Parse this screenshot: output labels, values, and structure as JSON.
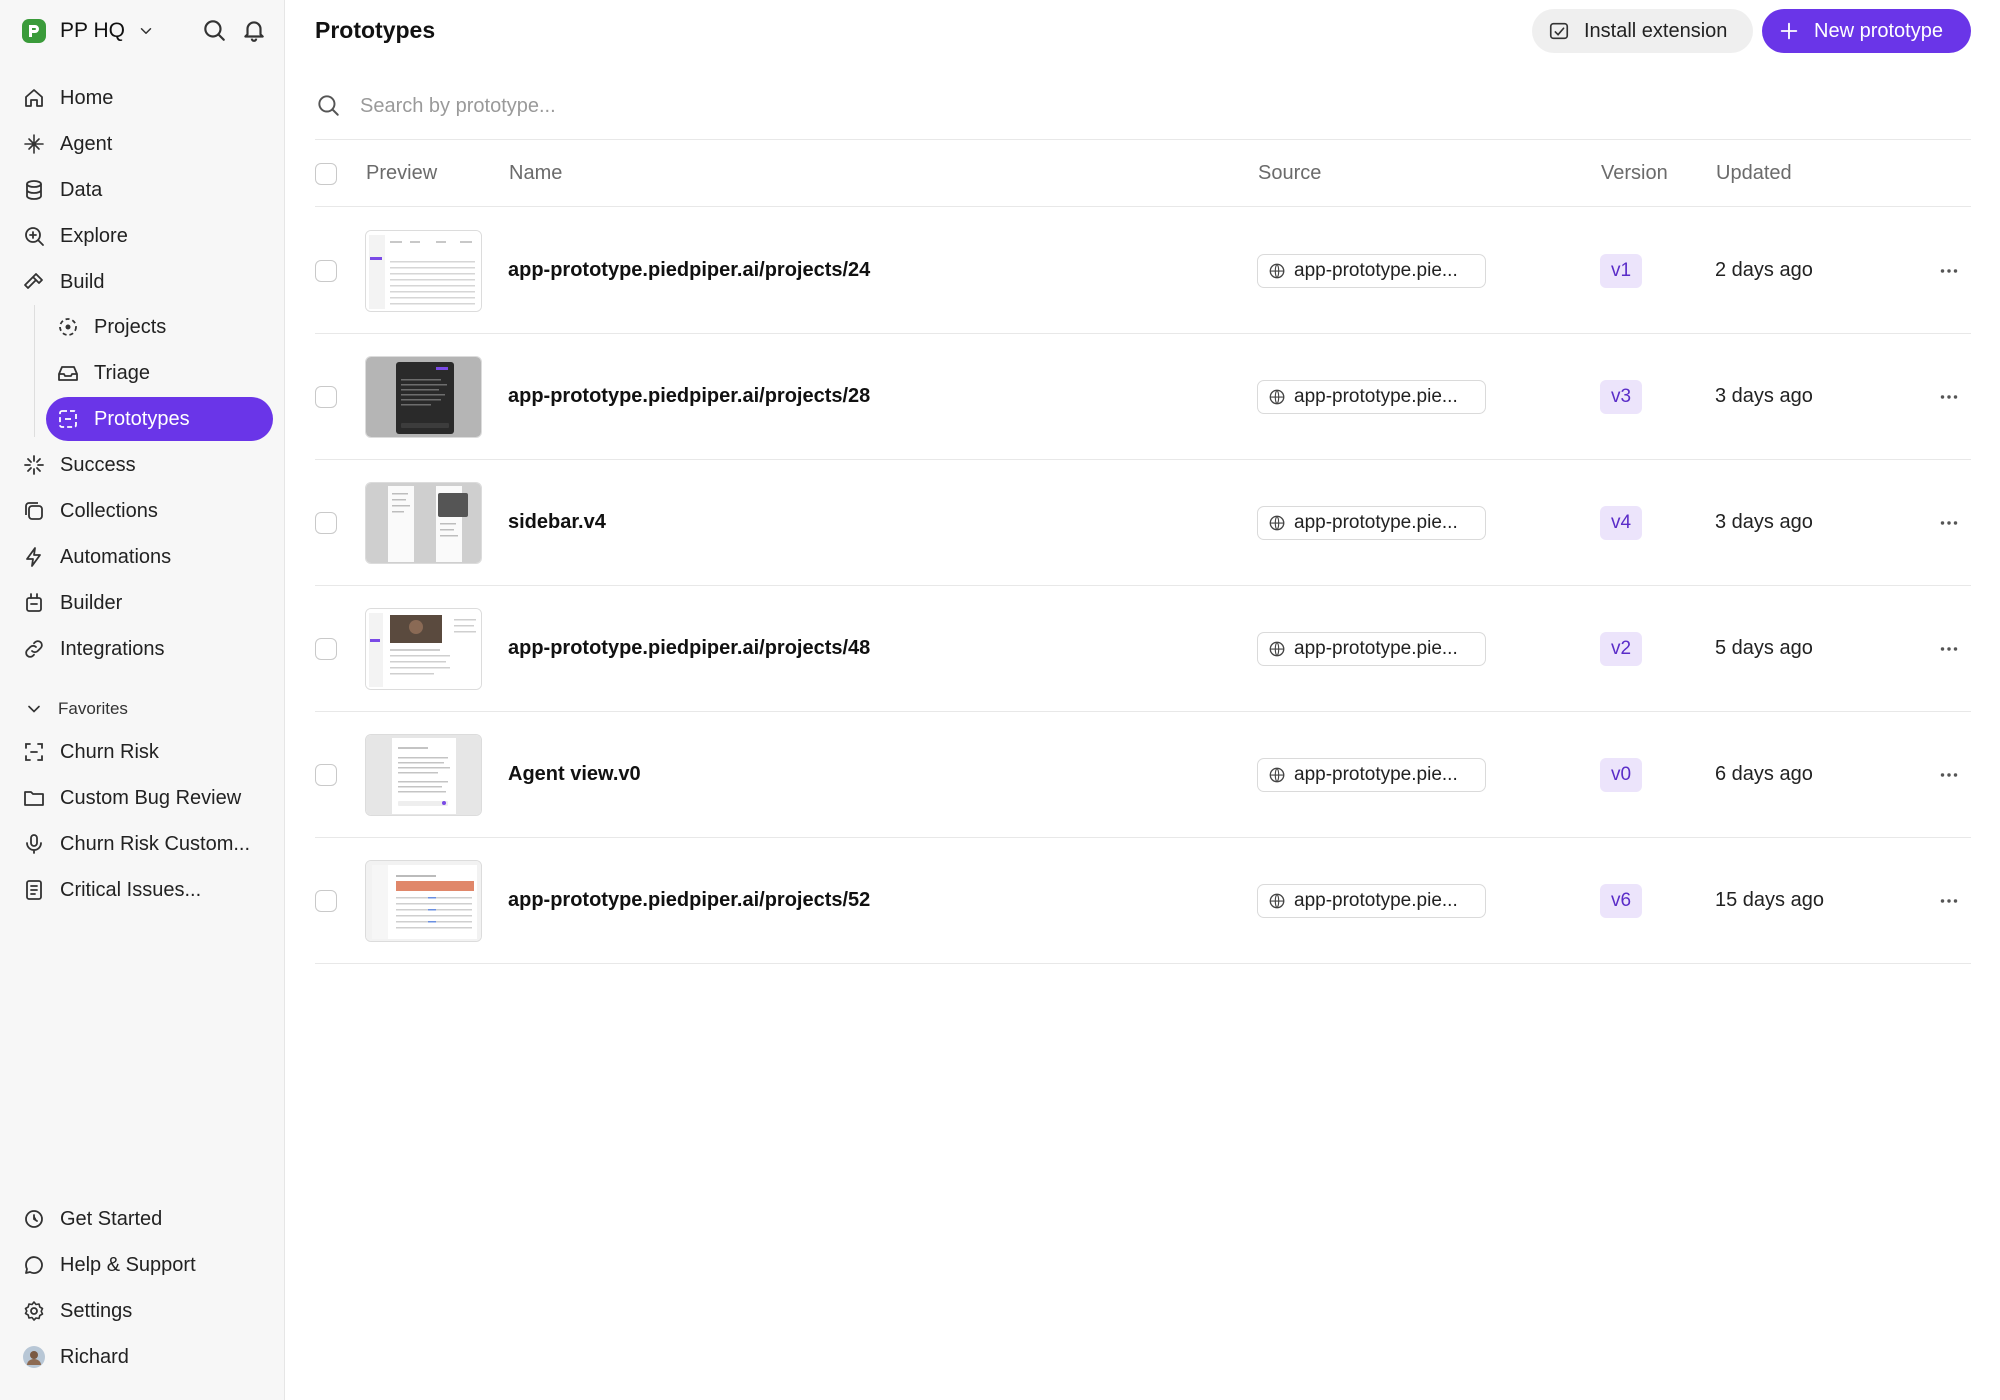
{
  "workspace": {
    "name": "PP HQ",
    "logo_color": "#3a9b3a"
  },
  "sidebar": {
    "nav": [
      {
        "label": "Home",
        "icon": "home-icon"
      },
      {
        "label": "Agent",
        "icon": "sparkle-icon"
      },
      {
        "label": "Data",
        "icon": "database-icon"
      },
      {
        "label": "Explore",
        "icon": "zoom-icon"
      },
      {
        "label": "Build",
        "icon": "hammer-icon"
      },
      {
        "label": "Projects",
        "icon": "projects-icon"
      },
      {
        "label": "Triage",
        "icon": "tray-icon"
      },
      {
        "label": "Prototypes",
        "icon": "prototype-icon",
        "active": true
      },
      {
        "label": "Success",
        "icon": "burst-icon"
      },
      {
        "label": "Collections",
        "icon": "collections-icon"
      },
      {
        "label": "Automations",
        "icon": "bolt-icon"
      },
      {
        "label": "Builder",
        "icon": "builder-icon"
      },
      {
        "label": "Integrations",
        "icon": "link-icon"
      }
    ],
    "favorites_heading": "Favorites",
    "favorites": [
      {
        "label": "Churn Risk",
        "icon": "scan-icon"
      },
      {
        "label": "Custom Bug Review",
        "icon": "folder-icon"
      },
      {
        "label": "Churn Risk Custom...",
        "icon": "mic-icon"
      },
      {
        "label": "Critical Issues...",
        "icon": "document-icon"
      }
    ],
    "bottom": [
      {
        "label": "Get Started",
        "icon": "clock-icon"
      },
      {
        "label": "Help & Support",
        "icon": "chat-icon"
      },
      {
        "label": "Settings",
        "icon": "gear-icon"
      },
      {
        "label": "Richard",
        "icon": "avatar"
      }
    ]
  },
  "header": {
    "title": "Prototypes",
    "install_label": "Install extension",
    "new_label": "New prototype",
    "accent": "#6a35e8"
  },
  "search": {
    "placeholder": "Search by prototype..."
  },
  "table": {
    "columns": {
      "preview": "Preview",
      "name": "Name",
      "source": "Source",
      "version": "Version",
      "updated": "Updated"
    },
    "rows": [
      {
        "name": "app-prototype.piedpiper.ai/projects/24",
        "source": "app-prototype.pie...",
        "version": "v1",
        "updated": "2 days ago"
      },
      {
        "name": "app-prototype.piedpiper.ai/projects/28",
        "source": "app-prototype.pie...",
        "version": "v3",
        "updated": "3 days ago"
      },
      {
        "name": "sidebar.v4",
        "source": "app-prototype.pie...",
        "version": "v4",
        "updated": "3 days ago"
      },
      {
        "name": "app-prototype.piedpiper.ai/projects/48",
        "source": "app-prototype.pie...",
        "version": "v2",
        "updated": "5 days ago"
      },
      {
        "name": "Agent view.v0",
        "source": "app-prototype.pie...",
        "version": "v0",
        "updated": "6 days ago"
      },
      {
        "name": "app-prototype.piedpiper.ai/projects/52",
        "source": "app-prototype.pie...",
        "version": "v6",
        "updated": "15 days ago"
      }
    ]
  }
}
